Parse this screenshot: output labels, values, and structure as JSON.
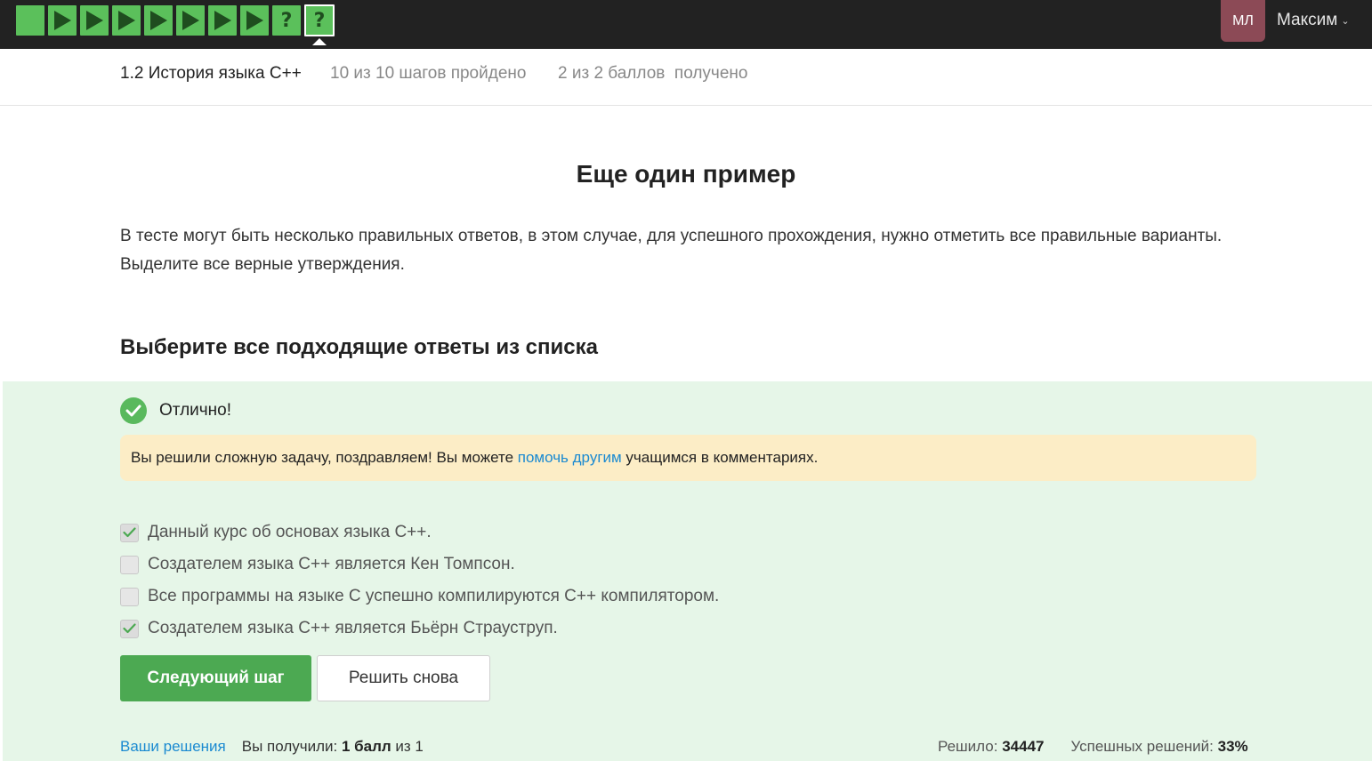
{
  "topbar": {
    "steps": [
      {
        "type": "text",
        "state": "done"
      },
      {
        "type": "video",
        "state": "done"
      },
      {
        "type": "video",
        "state": "done"
      },
      {
        "type": "video",
        "state": "done"
      },
      {
        "type": "video",
        "state": "done"
      },
      {
        "type": "video",
        "state": "done"
      },
      {
        "type": "video",
        "state": "done"
      },
      {
        "type": "video",
        "state": "done"
      },
      {
        "type": "quiz",
        "state": "done",
        "glyph": "?"
      },
      {
        "type": "quiz",
        "state": "current",
        "glyph": "?"
      }
    ],
    "avatar_initials": "МЛ",
    "avatar_color": "#8c4a56",
    "username": "Максим"
  },
  "lesson": {
    "title": "1.2 История языка C++",
    "steps_progress": "10 из 10 шагов пройдено",
    "score_progress": "2 из 2 баллов  получено"
  },
  "content": {
    "title": "Еще один пример",
    "lead": "В тесте могут быть несколько правильных ответов, в этом случае, для успешного прохождения, нужно отметить все правильные варианты. Выделите все верные утверждения.",
    "question": "Выберите все подходящие ответы из списка"
  },
  "feedback": {
    "status": "Отлично!",
    "hint_before": "Вы решили сложную задачу, поздравляем! Вы можете ",
    "hint_link": "помочь другим",
    "hint_after": " учащимся в комментариях."
  },
  "options": [
    {
      "label": "Данный курс об основах языка C++.",
      "checked": true
    },
    {
      "label": "Создателем языка C++ является Кен Томпсон.",
      "checked": false
    },
    {
      "label": "Все программы на языке С успешно компилируются С++ компилятором.",
      "checked": false
    },
    {
      "label": "Создателем языка C++ является Бьёрн Страуструп.",
      "checked": true
    }
  ],
  "buttons": {
    "next": "Следующий шаг",
    "retry": "Решить снова"
  },
  "footer": {
    "solutions_link": "Ваши решения",
    "you_got_label": "Вы получили: ",
    "you_got_value": "1 балл",
    "you_got_suffix": " из 1",
    "solved_label": "Решило: ",
    "solved_value": "34447",
    "success_label": "Успешных решений: ",
    "success_value": "33%"
  },
  "colors": {
    "topbar": "#222222",
    "step_green": "#5bc05b",
    "feedback_bg": "#e6f6e8",
    "hint_bg": "#fcedc6",
    "link": "#1b8ad1",
    "primary_button": "#4ca952"
  }
}
